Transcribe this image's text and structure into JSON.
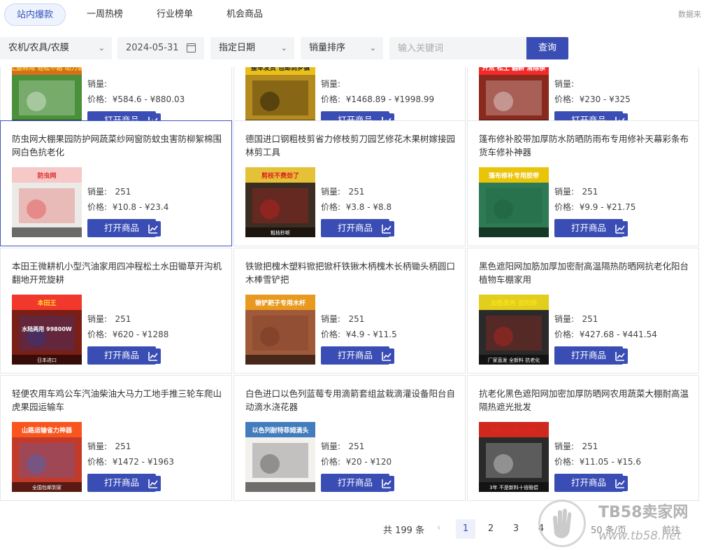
{
  "tabs": [
    {
      "label": "站内爆款",
      "active": true
    },
    {
      "label": "一周热榜",
      "active": false
    },
    {
      "label": "行业榜单",
      "active": false
    },
    {
      "label": "机会商品",
      "active": false
    }
  ],
  "filters": {
    "category": "农机/农具/农膜",
    "date": "2024-05-31",
    "date_mode": "指定日期",
    "sort": "销量排序",
    "keyword_placeholder": "输入关键词",
    "query_label": "查询",
    "source_note": "数据来"
  },
  "products": [
    {
      "title": "",
      "sales_label": "销量:",
      "sales": "",
      "price_label": "价格:",
      "price": "¥584.6 - ¥880.03",
      "open_label": "打开商品",
      "thumb_caption": "粘土厨样用  轻松不粘  动力强劲"
    },
    {
      "title": "",
      "sales_label": "销量:",
      "sales": "",
      "price_label": "价格:",
      "price": "¥1468.89 - ¥1998.99",
      "open_label": "打开商品",
      "thumb_caption": "整车发货 包邮到乡镇"
    },
    {
      "title": "",
      "sales_label": "销量:",
      "sales": "",
      "price_label": "价格:",
      "price": "¥230 - ¥325",
      "open_label": "打开商品",
      "thumb_caption": "开荒 松土 翻耕 清除杂"
    },
    {
      "title": "防虫网大棚果园防护网蔬菜纱网窗防蚊虫害防柳絮棉围网白色抗老化",
      "sales_label": "销量:",
      "sales": "251",
      "price_label": "价格:",
      "price": "¥10.8 - ¥23.4",
      "open_label": "打开商品",
      "thumb_caption": "防虫网"
    },
    {
      "title": "德国进口钢粗枝剪省力修枝剪刀园艺修花木果树嫁接园林剪工具",
      "sales_label": "销量:",
      "sales": "251",
      "price_label": "价格:",
      "price": "¥3.8 - ¥8.8",
      "open_label": "打开商品",
      "thumb_caption": "剪枝不费劲了",
      "thumb_caption2": "粗枝秒断"
    },
    {
      "title": "篷布修补胶带加厚防水防晒防雨布专用修补天幕彩条布货车修补神器",
      "sales_label": "销量:",
      "sales": "251",
      "price_label": "价格:",
      "price": "¥9.9 - ¥21.75",
      "open_label": "打开商品",
      "thumb_caption": "篷布修补专用胶带"
    },
    {
      "title": "本田王微耕机小型汽油家用四冲程松土水田锄草开沟机翻地开荒旋耕",
      "sales_label": "销量:",
      "sales": "251",
      "price_label": "价格:",
      "price": "¥620 - ¥1288",
      "open_label": "打开商品",
      "thumb_caption": "本田王",
      "thumb_caption2": "日本进口",
      "thumb_caption3": "水陆两用 99800W"
    },
    {
      "title": "铁锨把槐木塑料锨把锨杆铁锹木柄槐木长柄锄头柄圆口木棒雪铲把",
      "sales_label": "销量:",
      "sales": "251",
      "price_label": "价格:",
      "price": "¥4.9 - ¥11.5",
      "open_label": "打开商品",
      "thumb_caption": "锹铲耙子专用木杆"
    },
    {
      "title": "黑色遮阳网加筋加厚加密耐高温隔热防晒网抗老化阳台植物车棚家用",
      "sales_label": "销量:",
      "sales": "251",
      "price_label": "价格:",
      "price": "¥427.68 - ¥441.54",
      "open_label": "打开商品",
      "thumb_caption": "加筋黑色 遮阳网",
      "thumb_caption2": "厂家直发 全新料 抗老化"
    },
    {
      "title": "轻便农用车鸡公车汽油柴油大马力工地手推三轮车爬山虎果园运输车",
      "sales_label": "销量:",
      "sales": "251",
      "price_label": "价格:",
      "price": "¥1472 - ¥1963",
      "open_label": "打开商品",
      "thumb_caption": "山路运输省力神器",
      "thumb_caption2": "全国包邮到家"
    },
    {
      "title": "白色进口以色列蓝莓专用滴箭套组盆栽滴灌设备阳台自动滴水浇花器",
      "sales_label": "销量:",
      "sales": "251",
      "price_label": "价格:",
      "price": "¥20 - ¥120",
      "open_label": "打开商品",
      "thumb_caption": "以色列耐特菲姆滴头"
    },
    {
      "title": "抗老化黑色遮阳网加密加厚防晒网农用蔬菜大棚耐高温隔热遮光批发",
      "sales_label": "销量:",
      "sales": "251",
      "price_label": "价格:",
      "price": "¥11.05 - ¥15.6",
      "open_label": "打开商品",
      "thumb_caption": "8针/10针/12针",
      "thumb_caption2": "3年 不是新料十倍赔偿"
    }
  ],
  "pager": {
    "total": "共 199 条",
    "pages": [
      "1",
      "2",
      "3",
      "4"
    ],
    "current": "1",
    "page_size": "50 条/页",
    "goto": "前往"
  },
  "watermark": {
    "brand": "TB58卖家网",
    "url": "www.tb58.net"
  },
  "colors": {
    "accent": "#3a4db4",
    "tab_active_bg": "#eef3fe"
  }
}
